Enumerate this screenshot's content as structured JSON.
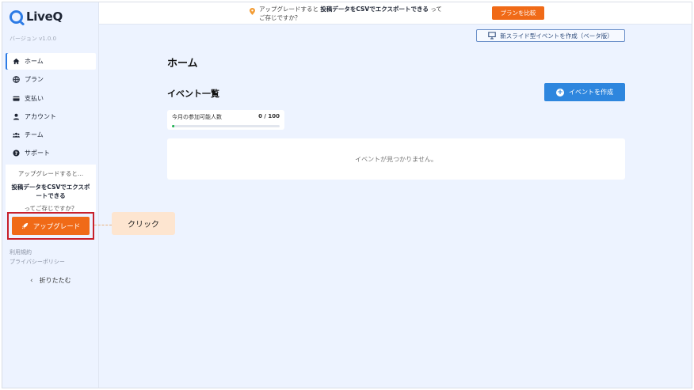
{
  "app": {
    "name": "LiveQ",
    "version": "バージョン v1.0.0"
  },
  "sidebar": {
    "items": [
      {
        "label": "ホーム",
        "icon": "home-icon"
      },
      {
        "label": "プラン",
        "icon": "globe-icon"
      },
      {
        "label": "支払い",
        "icon": "credit-card-icon"
      },
      {
        "label": "アカウント",
        "icon": "user-icon"
      },
      {
        "label": "チーム",
        "icon": "team-icon"
      },
      {
        "label": "サポート",
        "icon": "help-icon"
      }
    ],
    "promo": {
      "line1": "アップグレードすると...",
      "line2": "投稿データをCSVでエクスポートできる",
      "line3": "ってご存じですか？"
    },
    "upgrade_label": "アップグレード",
    "terms": "利用規約",
    "privacy": "プライバシーポリシー",
    "collapse_label": "折りたたむ"
  },
  "banner": {
    "text_prefix": "アップグレードすると",
    "text_bold": "投稿データをCSVでエクスポートできる",
    "text_suffix": "って",
    "text_line2": "ご存じですか？",
    "compare_label": "プランを比較"
  },
  "toolbar": {
    "slide_event_label": "新スライド型イベントを作成（ベータ版）"
  },
  "main": {
    "page_title": "ホーム",
    "section_title": "イベント一覧",
    "create_label": "イベントを作成",
    "usage": {
      "label": "今月の参加可能人数",
      "count": "0 / 100",
      "progress": 0.02
    },
    "empty_message": "イベントが見つかりません。"
  },
  "annotation": {
    "callout_text": "クリック"
  },
  "colors": {
    "accent": "#2c7be5",
    "orange": "#f06a17",
    "highlight": "#c8202a",
    "callout": "#fde5d0"
  }
}
